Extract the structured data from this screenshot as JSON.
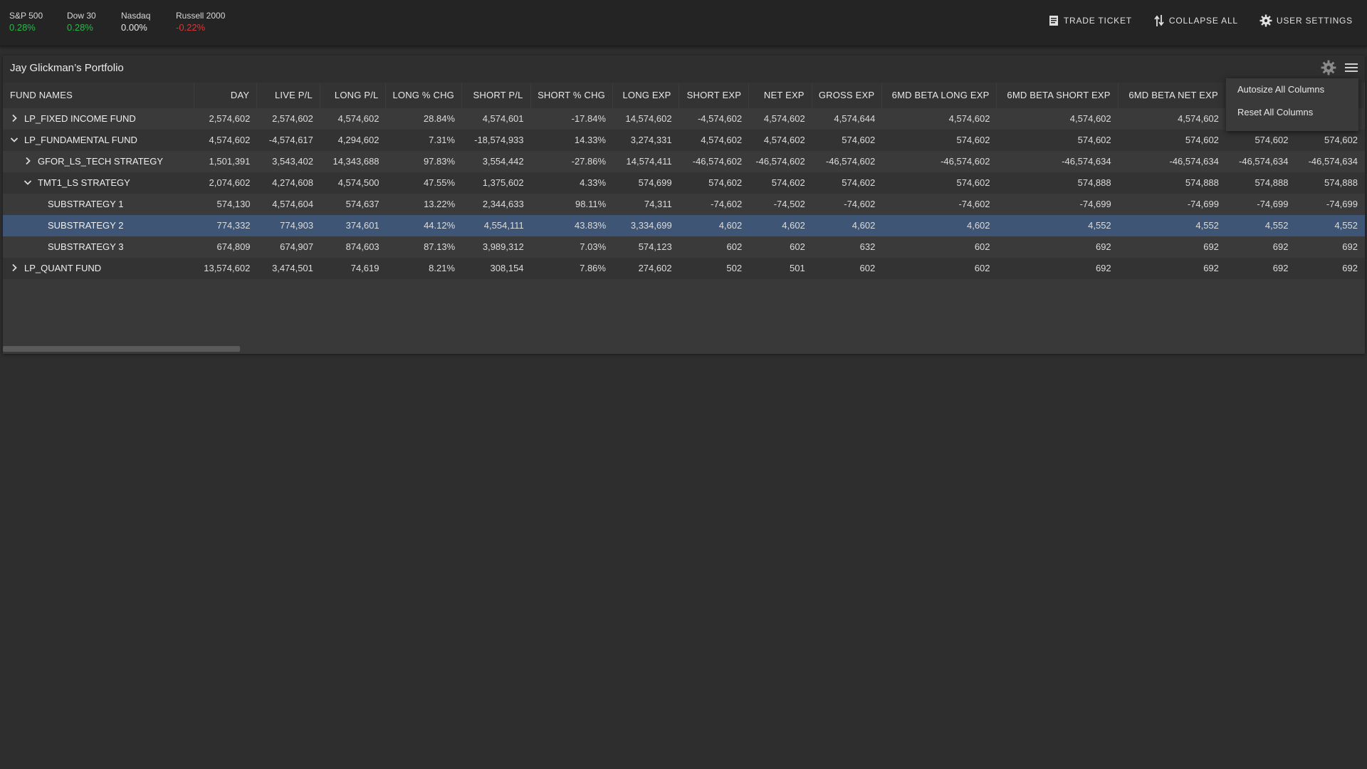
{
  "tickers": [
    {
      "name": "S&P 500",
      "value": "0.28%",
      "trend": "pos"
    },
    {
      "name": "Dow 30",
      "value": "0.28%",
      "trend": "pos"
    },
    {
      "name": "Nasdaq",
      "value": "0.00%",
      "trend": "neu"
    },
    {
      "name": "Russell 2000",
      "value": "-0.22%",
      "trend": "neg"
    }
  ],
  "actions": {
    "trade_ticket": "TRADE TICKET",
    "collapse_all": "COLLAPSE ALL",
    "user_settings": "USER SETTINGS"
  },
  "panel": {
    "title": "Jay Glickman’s Portfolio"
  },
  "menu": {
    "autosize": "Autosize All Columns",
    "reset": "Reset All Columns"
  },
  "columns": [
    "FUND NAMES",
    "DAY",
    "LIVE P/L",
    "LONG P/L",
    "LONG % CHG",
    "SHORT P/L",
    "SHORT % CHG",
    "LONG EXP",
    "SHORT EXP",
    "NET EXP",
    "GROSS EXP",
    "6MD BETA LONG EXP",
    "6MD BETA SHORT EXP",
    "6MD BETA NET EXP",
    "",
    ""
  ],
  "rows": [
    {
      "name": "LP_FIXED INCOME FUND",
      "level": 0,
      "expander": "collapsed",
      "selected": false,
      "values": [
        "2,574,602",
        "2,574,602",
        "4,574,602",
        "28.84%",
        "4,574,601",
        "-17.84%",
        "14,574,602",
        "-4,574,602",
        "4,574,602",
        "4,574,644",
        "4,574,602",
        "4,574,602",
        "4,574,602",
        "",
        ""
      ]
    },
    {
      "name": "LP_FUNDAMENTAL FUND",
      "level": 0,
      "expander": "expanded",
      "selected": false,
      "values": [
        "4,574,602",
        "-4,574,617",
        "4,294,602",
        "7.31%",
        "-18,574,933",
        "14.33%",
        "3,274,331",
        "4,574,602",
        "4,574,602",
        "574,602",
        "574,602",
        "574,602",
        "574,602",
        "574,602",
        "574,602"
      ]
    },
    {
      "name": "GFOR_LS_TECH STRATEGY",
      "level": 1,
      "expander": "collapsed",
      "selected": false,
      "values": [
        "1,501,391",
        "3,543,402",
        "14,343,688",
        "97.83%",
        "3,554,442",
        "-27.86%",
        "14,574,411",
        "-46,574,602",
        "-46,574,602",
        "-46,574,602",
        "-46,574,602",
        "-46,574,634",
        "-46,574,634",
        "-46,574,634",
        "-46,574,634"
      ]
    },
    {
      "name": "TMT1_LS STRATEGY",
      "level": 1,
      "expander": "expanded",
      "selected": false,
      "values": [
        "2,074,602",
        "4,274,608",
        "4,574,500",
        "47.55%",
        "1,375,602",
        "4.33%",
        "574,699",
        "574,602",
        "574,602",
        "574,602",
        "574,602",
        "574,888",
        "574,888",
        "574,888",
        "574,888"
      ]
    },
    {
      "name": "SUBSTRATEGY 1",
      "level": 2,
      "expander": "none",
      "selected": false,
      "values": [
        "574,130",
        "4,574,604",
        "574,637",
        "13.22%",
        "2,344,633",
        "98.11%",
        "74,311",
        "-74,602",
        "-74,502",
        "-74,602",
        "-74,602",
        "-74,699",
        "-74,699",
        "-74,699",
        "-74,699"
      ]
    },
    {
      "name": "SUBSTRATEGY 2",
      "level": 2,
      "expander": "none",
      "selected": true,
      "values": [
        "774,332",
        "774,903",
        "374,601",
        "44.12%",
        "4,554,111",
        "43.83%",
        "3,334,699",
        "4,602",
        "4,602",
        "4,602",
        "4,602",
        "4,552",
        "4,552",
        "4,552",
        "4,552"
      ]
    },
    {
      "name": "SUBSTRATEGY 3",
      "level": 2,
      "expander": "none",
      "selected": false,
      "values": [
        "674,809",
        "674,907",
        "874,603",
        "87.13%",
        "3,989,312",
        "7.03%",
        "574,123",
        "602",
        "602",
        "632",
        "602",
        "692",
        "692",
        "692",
        "692"
      ]
    },
    {
      "name": "LP_QUANT FUND",
      "level": 0,
      "expander": "collapsed",
      "selected": false,
      "values": [
        "13,574,602",
        "3,474,501",
        "74,619",
        "8.21%",
        "308,154",
        "7.86%",
        "274,602",
        "502",
        "501",
        "602",
        "602",
        "692",
        "692",
        "692",
        "692"
      ]
    }
  ],
  "colors": {
    "positive": "#2bb84a",
    "negative": "#d23a3a",
    "selected_row": "#3e5576"
  }
}
